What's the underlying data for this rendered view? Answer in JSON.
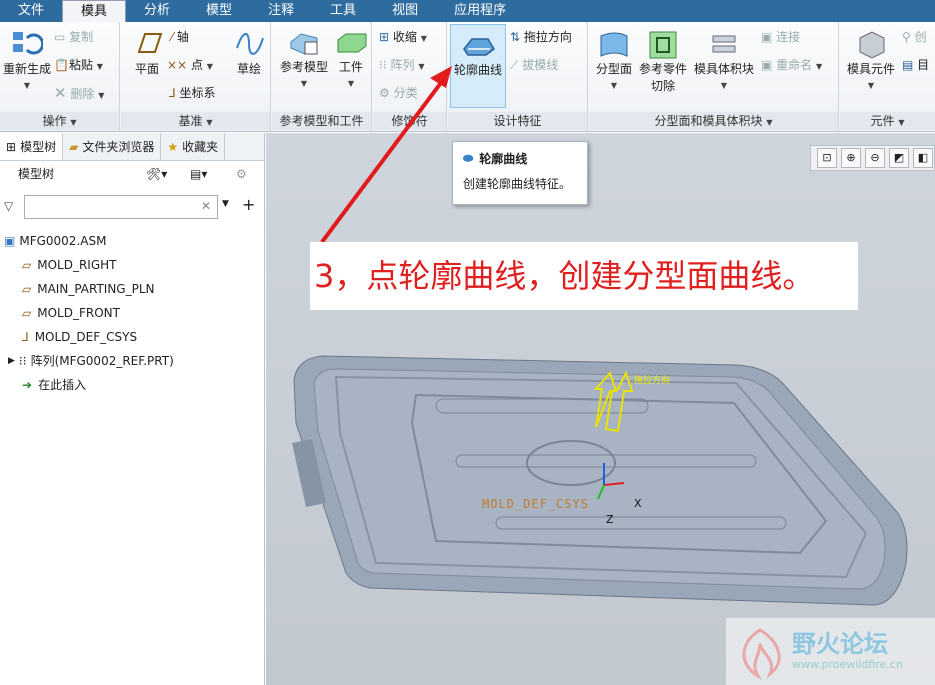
{
  "menu": [
    "文件",
    "模具",
    "分析",
    "模型",
    "注释",
    "工具",
    "视图",
    "应用程序"
  ],
  "ribbon": {
    "ops": {
      "label": "操作",
      "regen": "重新生成",
      "copy": "复制",
      "paste": "粘贴",
      "delete": "删除"
    },
    "datum": {
      "label": "基准",
      "plane": "平面",
      "axis": "轴",
      "point": "点",
      "csys": "坐标系",
      "sketch": "草绘"
    },
    "ref": {
      "label": "参考模型和工件",
      "refmodel": "参考模型",
      "workpiece": "工件"
    },
    "mod": {
      "label": "修饰符",
      "shrink": "收缩",
      "pattern": "阵列",
      "split": "分类"
    },
    "design": {
      "label": "设计特征",
      "silhouette": "轮廓曲线",
      "drag": "拖拉方向",
      "draft": "拔模线"
    },
    "parting": {
      "label": "分型面和模具体积块",
      "parting_surface": "分型面",
      "ref_cut_1": "参考零件",
      "ref_cut_2": "切除",
      "mold_volume": "模具体积块",
      "connect": "连接",
      "rename": "重命名"
    },
    "comp": {
      "label": "元件",
      "moldcomp": "模具元件",
      "create": "创",
      "item": "目"
    }
  },
  "panel": {
    "tabs": [
      "模型树",
      "文件夹浏览器",
      "收藏夹"
    ],
    "tree_title": "模型树",
    "items": [
      {
        "icon": "assembly-icon",
        "label": "MFG0002.ASM"
      },
      {
        "icon": "datum-plane-icon",
        "label": "MOLD_RIGHT"
      },
      {
        "icon": "datum-plane-icon",
        "label": "MAIN_PARTING_PLN"
      },
      {
        "icon": "datum-plane-icon",
        "label": "MOLD_FRONT"
      },
      {
        "icon": "csys-icon",
        "label": "MOLD_DEF_CSYS"
      },
      {
        "icon": "pattern-icon",
        "label": "阵列(MFG0002_REF.PRT)"
      },
      {
        "icon": "insert-arrow-icon",
        "label": "在此插入"
      }
    ]
  },
  "tooltip": {
    "title": "轮廓曲线",
    "desc": "创建轮廓曲线特征。"
  },
  "callout": "3，点轮廓曲线，创建分型面曲线。",
  "viewport": {
    "drag_label": "拖拉方向",
    "csys_label": "MOLD_DEF_CSYS",
    "axis_x": "X",
    "axis_z": "Z"
  },
  "watermark": {
    "brand": "野火论坛",
    "url": "www.proewildfire.cn"
  },
  "colors": {
    "menubar": "#2e6b9f",
    "callout_text": "#e0201f",
    "arrow": "#e11b1b",
    "part": "#9aa7b8"
  }
}
